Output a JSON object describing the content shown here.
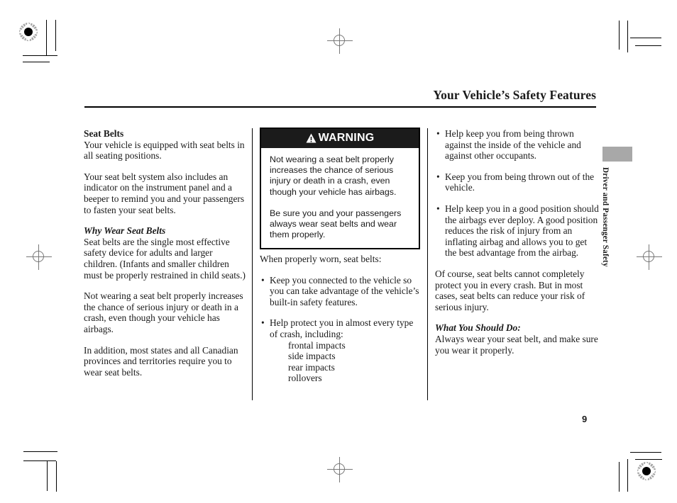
{
  "header": {
    "title": "Your Vehicle’s Safety Features"
  },
  "page_number": "9",
  "side_tab": {
    "label": "Driver and Passenger Safety",
    "block_color": "#a8a8a8"
  },
  "left_column": {
    "heading": "Seat Belts",
    "para1": "Your vehicle is equipped with seat belts in all seating positions.",
    "para2": "Your seat belt system also includes an indicator on the instrument panel and a beeper to remind you and your passengers to fasten your seat belts.",
    "subheading": "Why Wear Seat Belts",
    "para3": "Seat belts are the single most effective safety device for adults and larger children. (Infants and smaller children must be properly restrained in child seats.)",
    "para4": "Not wearing a seat belt properly increases the chance of serious injury or death in a crash, even though your vehicle has airbags.",
    "para5": "In addition, most states and all Canadian provinces and territories require you to wear seat belts."
  },
  "warning": {
    "icon": "warning-triangle-icon",
    "title": "WARNING",
    "para1": "Not wearing a seat belt properly increases the chance of serious injury or death in a crash, even though your vehicle has airbags.",
    "para2": "Be sure you and your passengers always wear seat belts and wear them properly.",
    "bg_color": "#1b1b1b",
    "text_color": "#ffffff"
  },
  "middle_column": {
    "intro": "When properly worn, seat belts:",
    "bullets": [
      {
        "text": "Keep you connected to the vehicle so you can take advantage of the vehicle’s built-in safety features.",
        "sub": []
      },
      {
        "text": "Help protect you in almost every type of crash, including:",
        "sub": [
          "frontal impacts",
          "side impacts",
          "rear impacts",
          "rollovers"
        ]
      }
    ]
  },
  "right_column": {
    "bullets": [
      "Help keep you from being thrown against the inside of the vehicle and against other occupants.",
      "Keep you from being thrown out of the vehicle.",
      "Help keep you in a good position should the airbags ever deploy. A good position reduces the risk of injury from an inflating airbag and allows you to get the best advantage from the airbag."
    ],
    "para1": "Of course, seat belts cannot completely protect you in every crash. But in most cases, seat belts can reduce your risk of serious injury.",
    "subheading": "What You Should Do:",
    "para2": "Always wear your seat belt, and make sure you wear it properly."
  },
  "bullet_glyph": "•"
}
